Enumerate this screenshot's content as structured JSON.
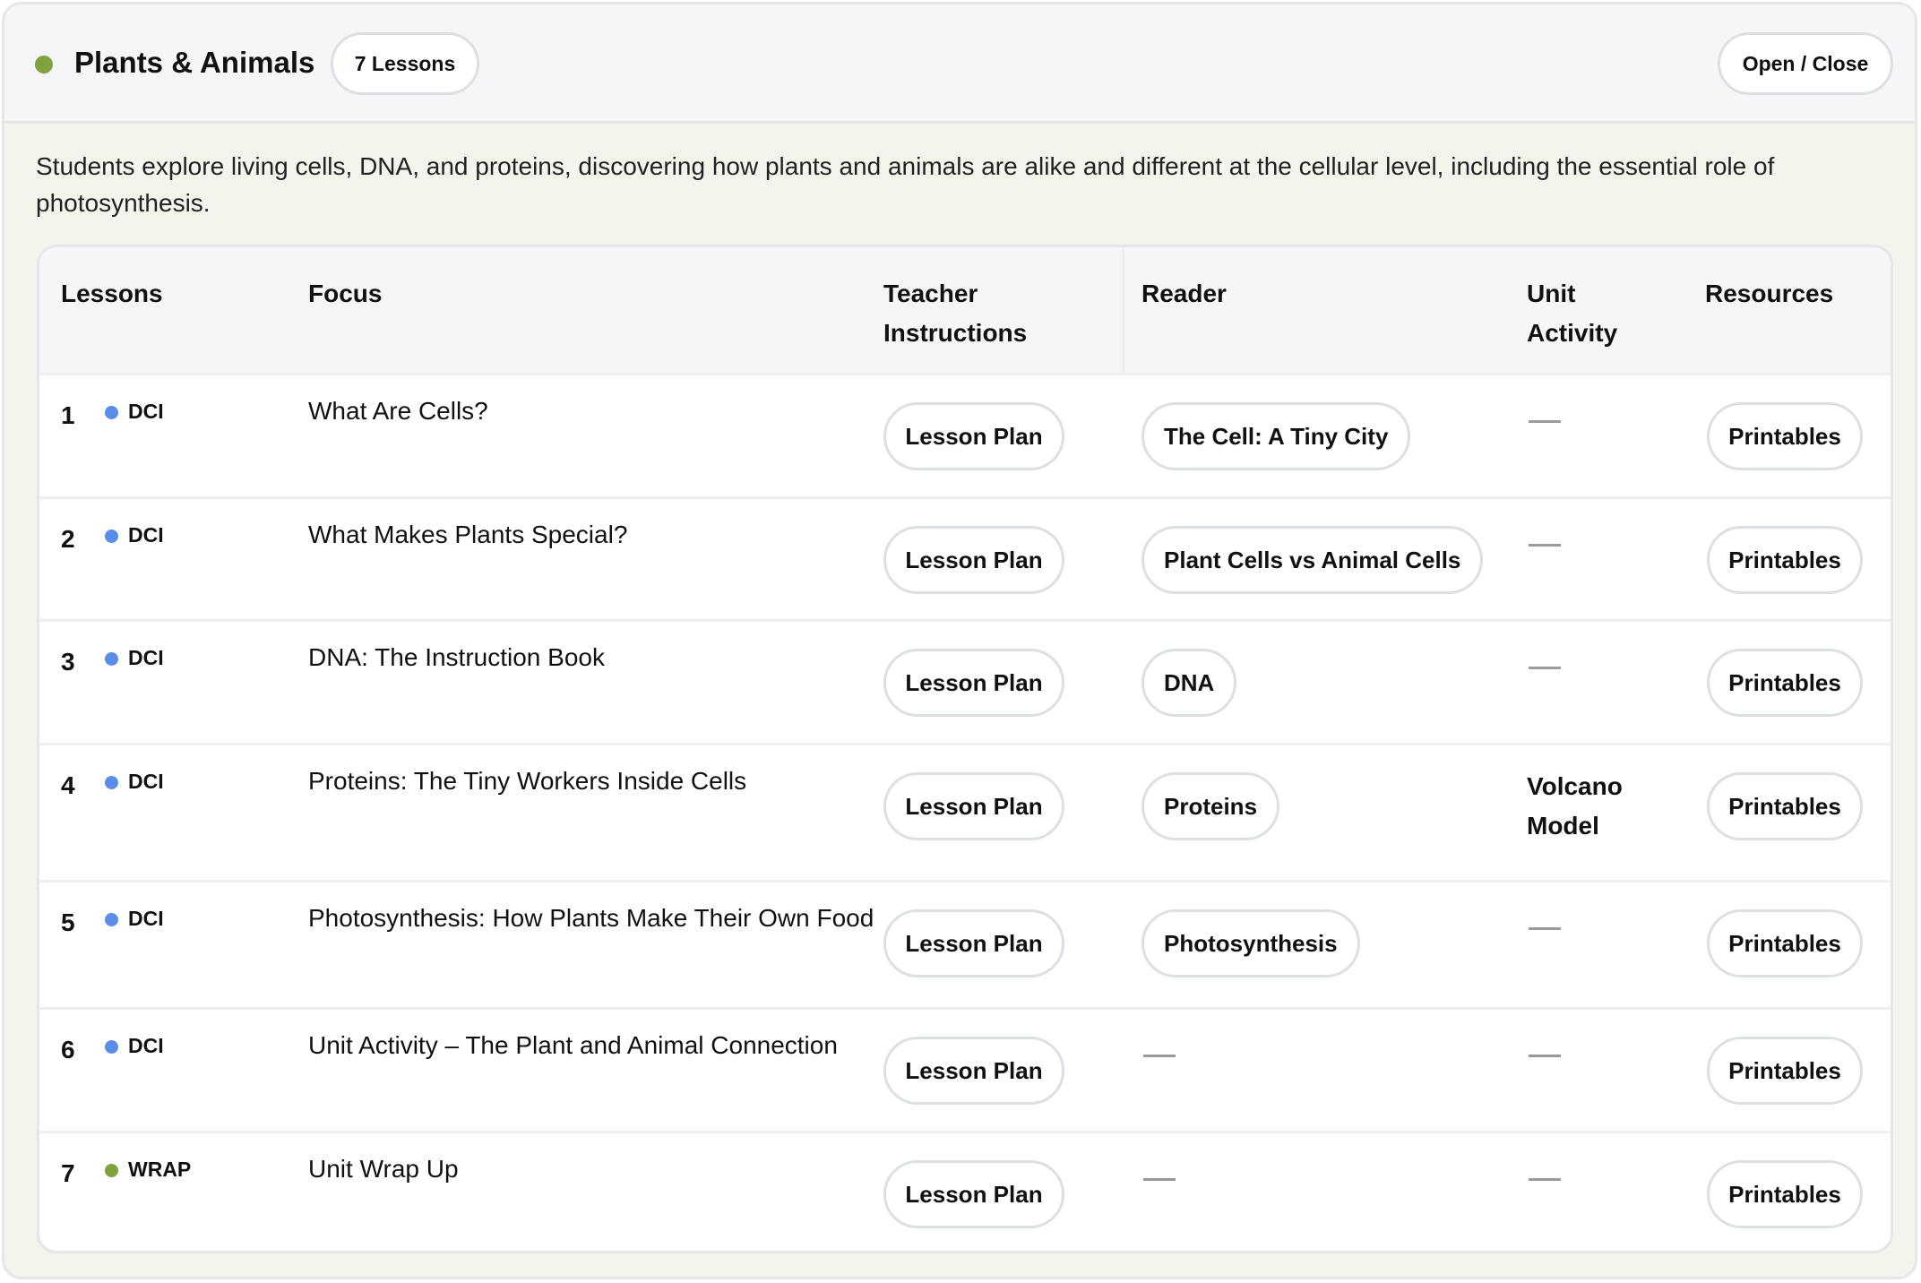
{
  "unit": {
    "title": "Plants & Animals",
    "lesson_count": "7 Lessons",
    "toggle_label": "Open / Close",
    "description": "Students explore living cells, DNA, and proteins, discovering how plants and animals are alike and different at the cellular level, including the essential role of photosynthesis.",
    "status_color": "#7ea23c"
  },
  "table": {
    "headers": {
      "lessons": "Lessons",
      "focus": "Focus",
      "teacher_instructions": "Teacher Instructions",
      "reader": "Reader",
      "unit_activity": "Unit Activity",
      "resources": "Resources"
    },
    "dash_symbol": "—",
    "rows": [
      {
        "num": "1",
        "tag": "DCI",
        "focus": "What Are Cells?",
        "lesson_plan": "Lesson Plan",
        "reader": "The Cell: A Tiny City",
        "activity": null,
        "resources": "Printables"
      },
      {
        "num": "2",
        "tag": "DCI",
        "focus": "What Makes Plants Special?",
        "lesson_plan": "Lesson Plan",
        "reader": "Plant Cells vs Animal Cells",
        "activity": null,
        "resources": "Printables"
      },
      {
        "num": "3",
        "tag": "DCI",
        "focus": "DNA: The Instruction Book",
        "lesson_plan": "Lesson Plan",
        "reader": "DNA",
        "activity": null,
        "resources": "Printables"
      },
      {
        "num": "4",
        "tag": "DCI",
        "focus": "Proteins: The Tiny Workers Inside Cells",
        "lesson_plan": "Lesson Plan",
        "reader": "Proteins",
        "activity": "Volcano Model",
        "resources": "Printables"
      },
      {
        "num": "5",
        "tag": "DCI",
        "focus": "Photosynthesis: How Plants Make Their Own Food",
        "lesson_plan": "Lesson Plan",
        "reader": "Photosynthesis",
        "activity": null,
        "resources": "Printables"
      },
      {
        "num": "6",
        "tag": "DCI",
        "focus": "Unit Activity – The Plant and Animal Connection",
        "lesson_plan": "Lesson Plan",
        "reader": null,
        "activity": null,
        "resources": "Printables"
      },
      {
        "num": "7",
        "tag": "WRAP",
        "focus": "Unit Wrap Up",
        "lesson_plan": "Lesson Plan",
        "reader": null,
        "activity": null,
        "resources": "Printables"
      }
    ]
  },
  "colors": {
    "tag_dci": "#5a8de8",
    "tag_wrap": "#7ea23c",
    "panel_background": "#f1f5eb"
  }
}
